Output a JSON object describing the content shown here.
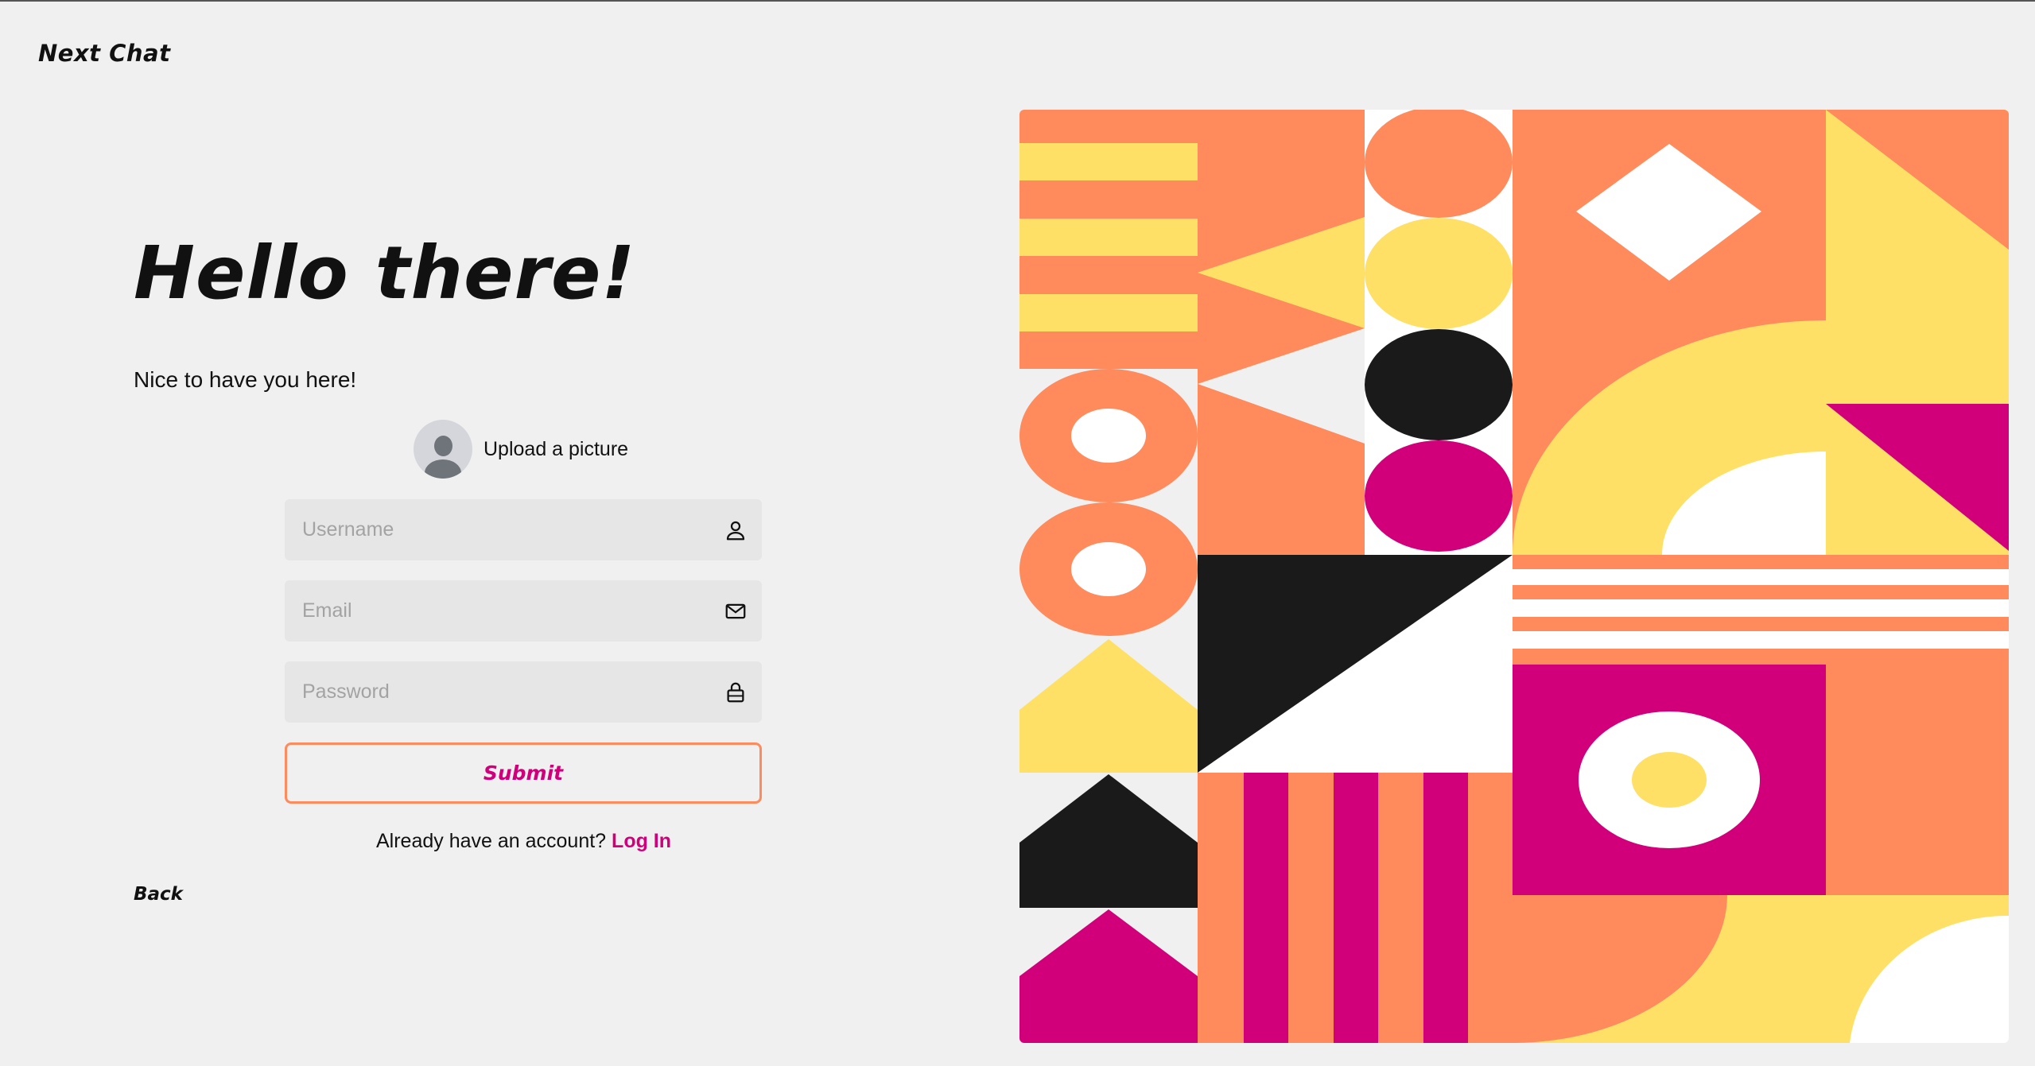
{
  "app": {
    "brand": "Next Chat"
  },
  "hero": {
    "title": "Hello there!",
    "subtitle": "Nice to have you here!"
  },
  "upload": {
    "label": "Upload a picture"
  },
  "form": {
    "username_placeholder": "Username",
    "email_placeholder": "Email",
    "password_placeholder": "Password",
    "username_icon": "user-icon",
    "email_icon": "mail-icon",
    "password_icon": "lock-icon",
    "submit_label": "Submit"
  },
  "footer": {
    "login_prompt": "Already have an account?",
    "login_link": "Log In",
    "back_label": "Back"
  },
  "colors": {
    "background": "#f0f0f0",
    "accent": "#d1007a",
    "orange": "#ff8a5c",
    "yellow": "#ffe066",
    "black": "#1a1a1a",
    "field_bg": "#e6e6e6"
  }
}
